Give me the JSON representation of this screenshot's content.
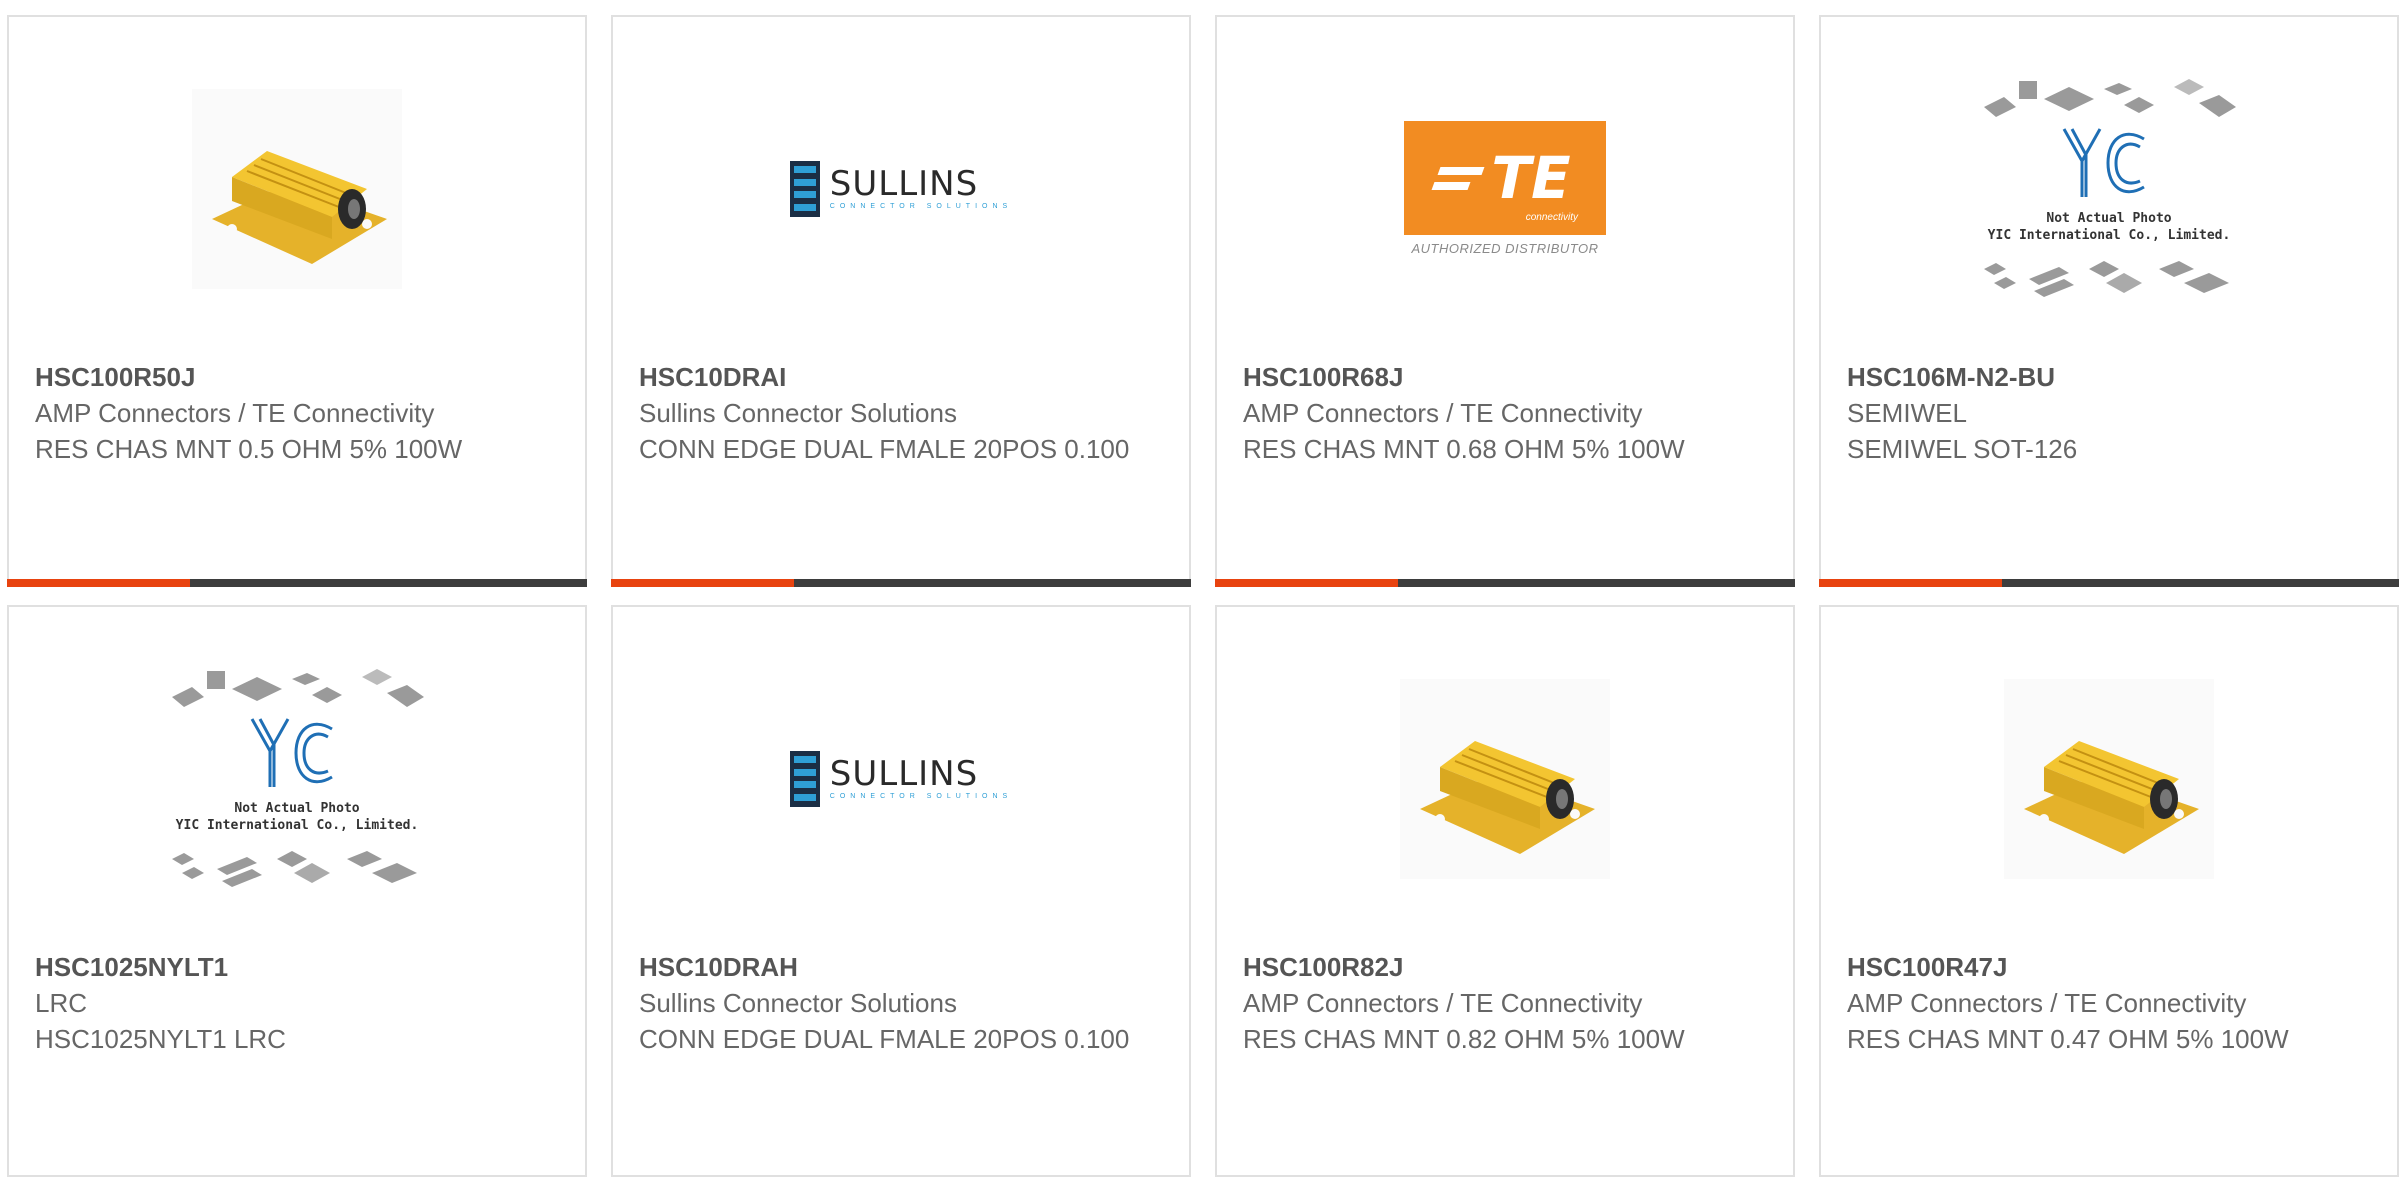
{
  "products": [
    {
      "part_number": "HSC100R50J",
      "manufacturer": "AMP Connectors / TE Connectivity",
      "description": "RES CHAS MNT 0.5 OHM 5% 100W",
      "image": "resistor"
    },
    {
      "part_number": "HSC10DRAI",
      "manufacturer": "Sullins Connector Solutions",
      "description": "CONN EDGE DUAL FMALE 20POS 0.100",
      "image": "sullins-logo"
    },
    {
      "part_number": "HSC100R68J",
      "manufacturer": "AMP Connectors / TE Connectivity",
      "description": "RES CHAS MNT 0.68 OHM 5% 100W",
      "image": "te-logo"
    },
    {
      "part_number": "HSC106M-N2-BU",
      "manufacturer": "SEMIWEL",
      "description": "SEMIWEL SOT-126",
      "image": "yic-placeholder"
    },
    {
      "part_number": "HSC1025NYLT1",
      "manufacturer": "LRC",
      "description": "HSC1025NYLT1 LRC",
      "image": "yic-placeholder"
    },
    {
      "part_number": "HSC10DRAH",
      "manufacturer": "Sullins Connector Solutions",
      "description": "CONN EDGE DUAL FMALE 20POS 0.100",
      "image": "sullins-logo"
    },
    {
      "part_number": "HSC100R82J",
      "manufacturer": "AMP Connectors / TE Connectivity",
      "description": "RES CHAS MNT 0.82 OHM 5% 100W",
      "image": "resistor"
    },
    {
      "part_number": "HSC100R47J",
      "manufacturer": "AMP Connectors / TE Connectivity",
      "description": "RES CHAS MNT 0.47 OHM 5% 100W",
      "image": "resistor"
    }
  ],
  "logos": {
    "sullins_word": "SULLINS",
    "sullins_tagline": "CONNECTOR SOLUTIONS",
    "te_letters": "TE",
    "te_sub": "connectivity",
    "te_authorized": "AUTHORIZED DISTRIBUTOR",
    "yic_line1": "Not Actual Photo",
    "yic_line2": "YIC International Co., Limited."
  },
  "colors": {
    "accent_bar": "#e8430f",
    "dark_bar": "#3d3d3d",
    "resistor_gold": "#f3c531",
    "te_orange": "#f28c22",
    "yic_blue": "#1f6fb5"
  }
}
